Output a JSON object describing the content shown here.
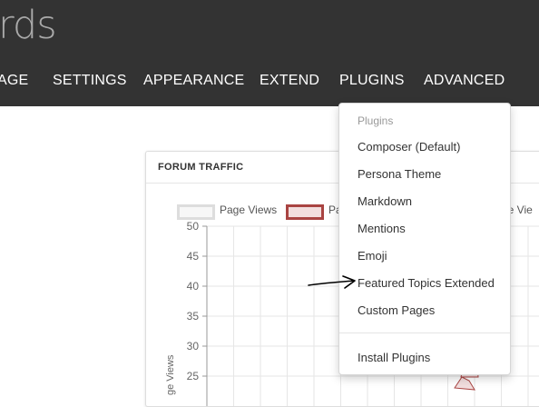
{
  "brand": {
    "logo_text": "rds"
  },
  "nav": {
    "items": [
      {
        "label": "AGE"
      },
      {
        "label": "SETTINGS"
      },
      {
        "label": "APPEARANCE"
      },
      {
        "label": "EXTEND"
      },
      {
        "label": "PLUGINS"
      },
      {
        "label": "ADVANCED"
      }
    ]
  },
  "plugins_menu": {
    "header": "Plugins",
    "items": [
      {
        "label": "Composer (Default)"
      },
      {
        "label": "Persona Theme"
      },
      {
        "label": "Markdown"
      },
      {
        "label": "Mentions"
      },
      {
        "label": "Emoji"
      },
      {
        "label": "Featured Topics Extended"
      },
      {
        "label": "Custom Pages"
      }
    ],
    "install_label": "Install Plugins"
  },
  "traffic": {
    "title": "FORUM TRAFFIC",
    "legend": [
      {
        "label": "Page Views",
        "color": "#dddddd"
      },
      {
        "label": "Pa",
        "color": "#a94442"
      },
      {
        "label": "ge Vie",
        "color": "#cccccc"
      }
    ]
  },
  "chart_data": {
    "type": "line",
    "title": "FORUM TRAFFIC",
    "ylabel": "ge Views",
    "xlabel": "",
    "ylim": [
      25,
      50
    ],
    "yticks": [
      50,
      45,
      40,
      35,
      30,
      25
    ],
    "grid": true,
    "legend_position": "top",
    "series": [
      {
        "name": "Page Views",
        "color": "#dddddd"
      },
      {
        "name": "Pa",
        "color": "#a94442"
      },
      {
        "name": "ge Vie",
        "color": "#cccccc"
      }
    ]
  },
  "colors": {
    "header_bg": "#333333",
    "accent_red": "#a94442"
  }
}
